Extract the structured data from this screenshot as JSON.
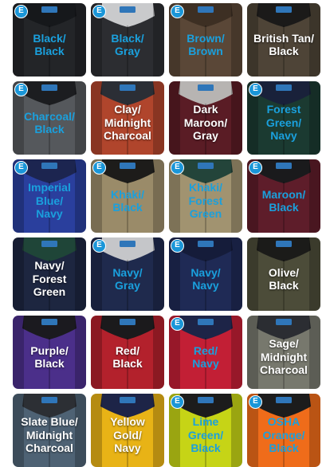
{
  "badge_text": "E",
  "swatches": [
    {
      "label": "Black/\nBlack",
      "body": "#232528",
      "collar": "#16181b",
      "text": "blue",
      "badge": true
    },
    {
      "label": "Black/\nGray",
      "body": "#2c2d31",
      "collar": "#c9cacc",
      "text": "blue",
      "badge": true
    },
    {
      "label": "Brown/\nBrown",
      "body": "#5a4737",
      "collar": "#3d2f23",
      "text": "blue",
      "badge": true
    },
    {
      "label": "British Tan/\nBlack",
      "body": "#4e4437",
      "collar": "#1b1a19",
      "text": "light",
      "badge": false
    },
    {
      "label": "Charcoal/\nBlack",
      "body": "#55585c",
      "collar": "#1c1d20",
      "text": "blue",
      "badge": true
    },
    {
      "label": "Clay/\nMidnight\nCharcoal",
      "body": "#b0452c",
      "collar": "#2b2e35",
      "text": "light",
      "badge": false
    },
    {
      "label": "Dark\nMaroon/\nGray",
      "body": "#5a1c25",
      "collar": "#b7b4b2",
      "text": "light",
      "badge": false
    },
    {
      "label": "Forest\nGreen/\nNavy",
      "body": "#1b3a31",
      "collar": "#19213a",
      "text": "blue",
      "badge": true
    },
    {
      "label": "Imperial\nBlue/\nNavy",
      "body": "#2a3f9d",
      "collar": "#1c2550",
      "text": "blue",
      "badge": true
    },
    {
      "label": "Khaki/\nBlack",
      "body": "#9a8b69",
      "collar": "#1d1c1a",
      "text": "blue",
      "badge": true
    },
    {
      "label": "Khaki/\nForest\nGreen",
      "body": "#a19370",
      "collar": "#23443a",
      "text": "blue",
      "badge": true
    },
    {
      "label": "Maroon/\nBlack",
      "body": "#5e1d2a",
      "collar": "#1a1a1c",
      "text": "blue",
      "badge": true
    },
    {
      "label": "Navy/\nForest\nGreen",
      "body": "#1d2640",
      "collar": "#1f4538",
      "text": "light",
      "badge": false
    },
    {
      "label": "Navy/\nGray",
      "body": "#1f2a4d",
      "collar": "#c5c6c9",
      "text": "blue",
      "badge": true
    },
    {
      "label": "Navy/\nNavy",
      "body": "#1f2a55",
      "collar": "#151c3a",
      "text": "blue",
      "badge": true
    },
    {
      "label": "Olive/\nBlack",
      "body": "#4c4c39",
      "collar": "#1b1b19",
      "text": "light",
      "badge": false
    },
    {
      "label": "Purple/\nBlack",
      "body": "#4b2f8a",
      "collar": "#1b1a1f",
      "text": "light",
      "badge": false
    },
    {
      "label": "Red/\nBlack",
      "body": "#b3212c",
      "collar": "#1b1a1c",
      "text": "light",
      "badge": false
    },
    {
      "label": "Red/\nNavy",
      "body": "#c21f35",
      "collar": "#1d2447",
      "text": "blue",
      "badge": true
    },
    {
      "label": "Sage/\nMidnight\nCharcoal",
      "body": "#77786d",
      "collar": "#2b2d32",
      "text": "light",
      "badge": false
    },
    {
      "label": "Slate Blue/\nMidnight\nCharcoal",
      "body": "#4e6274",
      "collar": "#2c2f34",
      "text": "light",
      "badge": false
    },
    {
      "label": "Yellow\nGold/\nNavy",
      "body": "#e8b316",
      "collar": "#1d2447",
      "text": "light",
      "badge": false
    },
    {
      "label": "Lime\nGreen/\nBlack",
      "body": "#c6d416",
      "collar": "#1c1c1c",
      "text": "blue",
      "badge": true
    },
    {
      "label": "OSHA\nOrange/\nBlack",
      "body": "#ef6c1a",
      "collar": "#1c1c1c",
      "text": "blue",
      "badge": true
    }
  ]
}
